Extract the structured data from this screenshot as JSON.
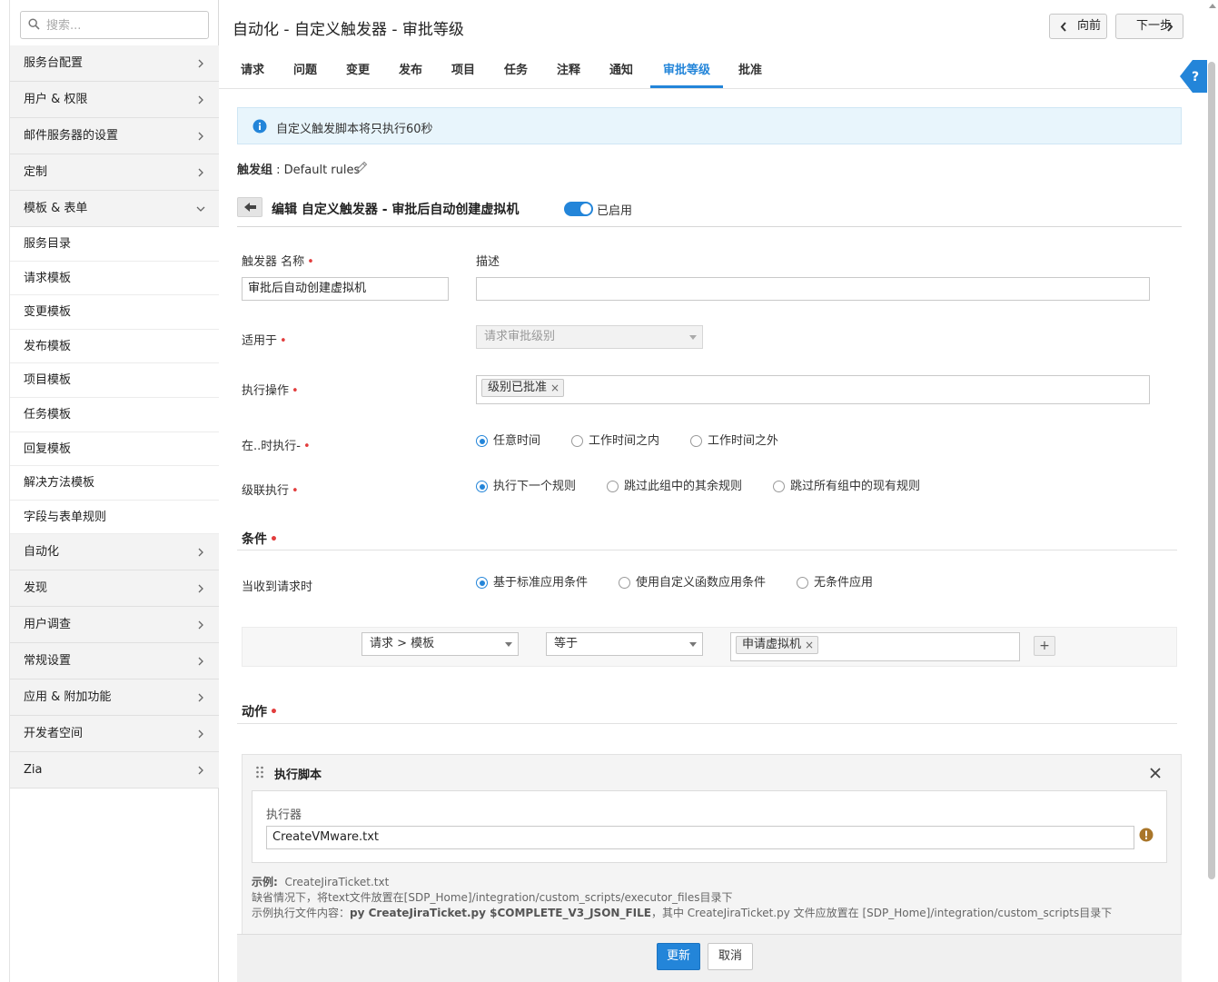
{
  "sidebar": {
    "search_placeholder": "搜索...",
    "items_top": [
      "服务台配置",
      "用户 & 权限",
      "邮件服务器的设置",
      "定制",
      "模板 & 表单"
    ],
    "sub_items": [
      "服务目录",
      "请求模板",
      "变更模板",
      "发布模板",
      "项目模板",
      "任务模板",
      "回复模板",
      "解决方法模板",
      "字段与表单规则"
    ],
    "items_bottom": [
      "自动化",
      "发现",
      "用户调查",
      "常规设置",
      "应用 & 附加功能",
      "开发者空间",
      "Zia"
    ]
  },
  "header": {
    "title": "自动化 - 自定义触发器 - 审批等级",
    "prev_label": "向前",
    "next_label": "下一步"
  },
  "tabs": [
    "请求",
    "问题",
    "变更",
    "发布",
    "项目",
    "任务",
    "注释",
    "通知",
    "审批等级",
    "批准"
  ],
  "active_tab": "审批等级",
  "info_text": "自定义触发脚本将只执行60秒",
  "trigger_group": {
    "label": "触发组",
    "value": " : Default rules"
  },
  "edit": {
    "title": "编辑 自定义触发器 - 审批后自动创建虚拟机",
    "toggle_label": "已启用",
    "toggle_on": true
  },
  "form": {
    "name_label": "触发器 名称",
    "name_value": "审批后自动创建虚拟机",
    "desc_label": "描述",
    "desc_value": "",
    "applies_label": "适用于",
    "applies_value": "请求审批级别",
    "action_label": "执行操作",
    "action_chip": "级别已批准",
    "when_label": "在..时执行-",
    "when_options": [
      "任意时间",
      "工作时间之内",
      "工作时间之外"
    ],
    "when_selected": 0,
    "cascade_label": "级联执行",
    "cascade_options": [
      "执行下一个规则",
      "跳过此组中的其余规则",
      "跳过所有组中的现有规则"
    ],
    "cascade_selected": 0
  },
  "conditions": {
    "title": "条件",
    "when_label": "当收到请求时",
    "options": [
      "基于标准应用条件",
      "使用自定义函数应用条件",
      "无条件应用"
    ],
    "selected": 0,
    "field": "请求 > 模板",
    "operator": "等于",
    "value_chip": "申请虚拟机",
    "add_label": "+"
  },
  "actions": {
    "title": "动作",
    "block_title": "执行脚本",
    "executor_label": "执行器",
    "executor_value": "CreateVMware.txt",
    "example_label": "示例:",
    "example_value": "CreateJiraTicket.txt",
    "help_line2": "缺省情况下，将text文件放置在[SDP_Home]/integration/custom_scripts/executor_files目录下",
    "help_line3_prefix": "示例执行文件内容：",
    "help_line3_bold": "py CreateJiraTicket.py $COMPLETE_V3_JSON_FILE",
    "help_line3_suffix": "，其中 CreateJiraTicket.py 文件应放置在 [SDP_Home]/integration/custom_scripts目录下"
  },
  "footer": {
    "update_label": "更新",
    "cancel_label": "取消"
  },
  "colors": {
    "accent": "#2385d9",
    "required": "#e23d3d",
    "warning": "#a9762a"
  }
}
